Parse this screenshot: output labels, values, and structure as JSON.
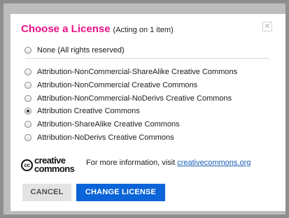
{
  "dialog": {
    "title": "Choose a License",
    "subtitle": "(Acting on 1 item)",
    "close_icon": "close-icon",
    "close_glyph": "✕"
  },
  "options": [
    {
      "label": "None (All rights reserved)",
      "checked": false
    },
    {
      "label": "Attribution-NonCommercial-ShareAlike Creative Commons",
      "checked": false
    },
    {
      "label": "Attribution-NonCommercial Creative Commons",
      "checked": false
    },
    {
      "label": "Attribution-NonCommercial-NoDerivs Creative Commons",
      "checked": false
    },
    {
      "label": "Attribution Creative Commons",
      "checked": true
    },
    {
      "label": "Attribution-ShareAlike Creative Commons",
      "checked": false
    },
    {
      "label": "Attribution-NoDerivs Creative Commons",
      "checked": false
    }
  ],
  "logo": {
    "cc_mark": "cc",
    "word_top": "creative",
    "word_bottom": "commons"
  },
  "info": {
    "text": "For more information, visit ",
    "link": "creativecommons.org"
  },
  "buttons": {
    "cancel": "CANCEL",
    "change": "CHANGE LICENSE"
  },
  "colors": {
    "title": "#ee1188",
    "primary_button": "#0b64d8",
    "link": "#1a5fb4"
  }
}
